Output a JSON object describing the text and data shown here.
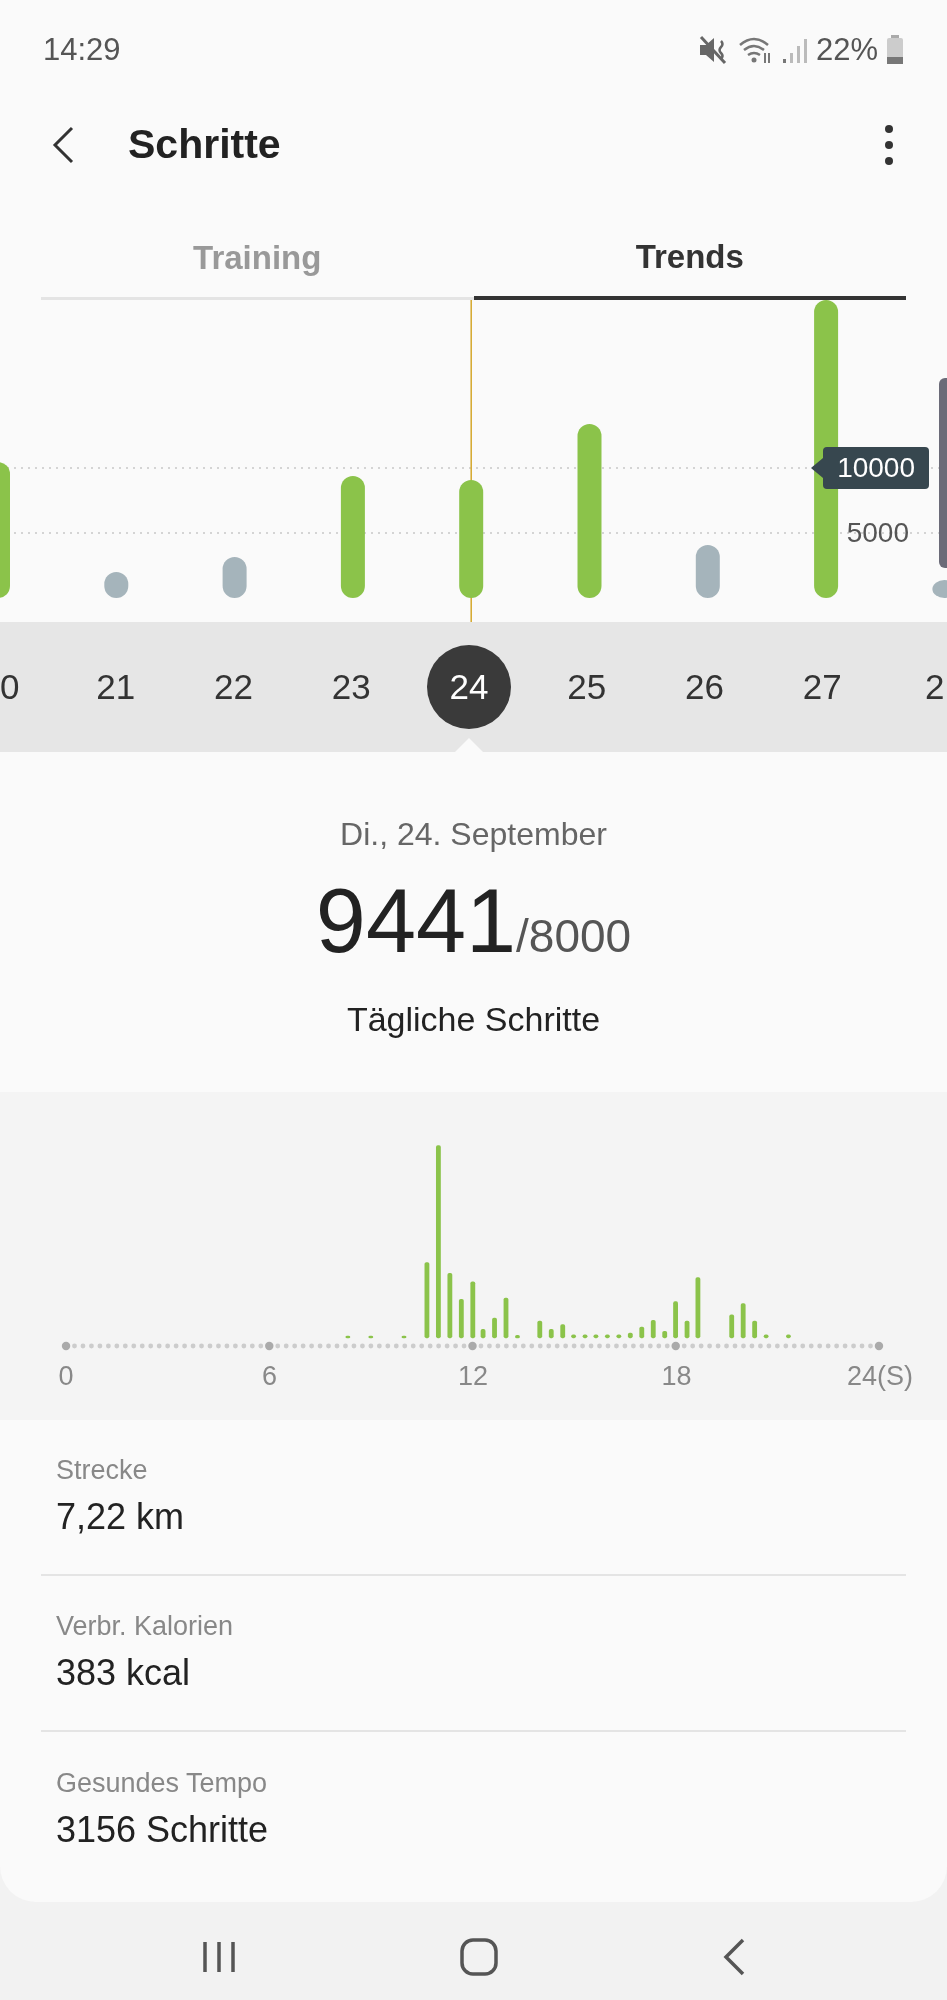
{
  "status_bar": {
    "time": "14:29",
    "battery": "22%"
  },
  "header": {
    "title": "Schritte"
  },
  "tabs": [
    {
      "label": "Training",
      "selected": false
    },
    {
      "label": "Trends",
      "selected": true
    }
  ],
  "trend_chart": {
    "goal_badge": "10000",
    "tick_label": "5000"
  },
  "days": [
    {
      "label": "0",
      "selected": false,
      "goal_met": true
    },
    {
      "label": "21",
      "selected": false,
      "goal_met": false
    },
    {
      "label": "22",
      "selected": false,
      "goal_met": false
    },
    {
      "label": "23",
      "selected": false,
      "goal_met": true
    },
    {
      "label": "24",
      "selected": true,
      "goal_met": true
    },
    {
      "label": "25",
      "selected": false,
      "goal_met": true
    },
    {
      "label": "26",
      "selected": false,
      "goal_met": false
    },
    {
      "label": "27",
      "selected": false,
      "goal_met": true
    },
    {
      "label": "2",
      "selected": false,
      "goal_met": false
    }
  ],
  "summary": {
    "date": "Di., 24. September",
    "steps": "9441",
    "goal": "/8000",
    "label": "Tägliche Schritte"
  },
  "hourly_chart": {
    "axis_labels": [
      "0",
      "6",
      "12",
      "18",
      "24(S)"
    ]
  },
  "stats": [
    {
      "label": "Strecke",
      "value": "7,22 km"
    },
    {
      "label": "Verbr. Kalorien",
      "value": "383 kcal"
    },
    {
      "label": "Gesundes Tempo",
      "value": "3156 Schritte"
    }
  ]
}
